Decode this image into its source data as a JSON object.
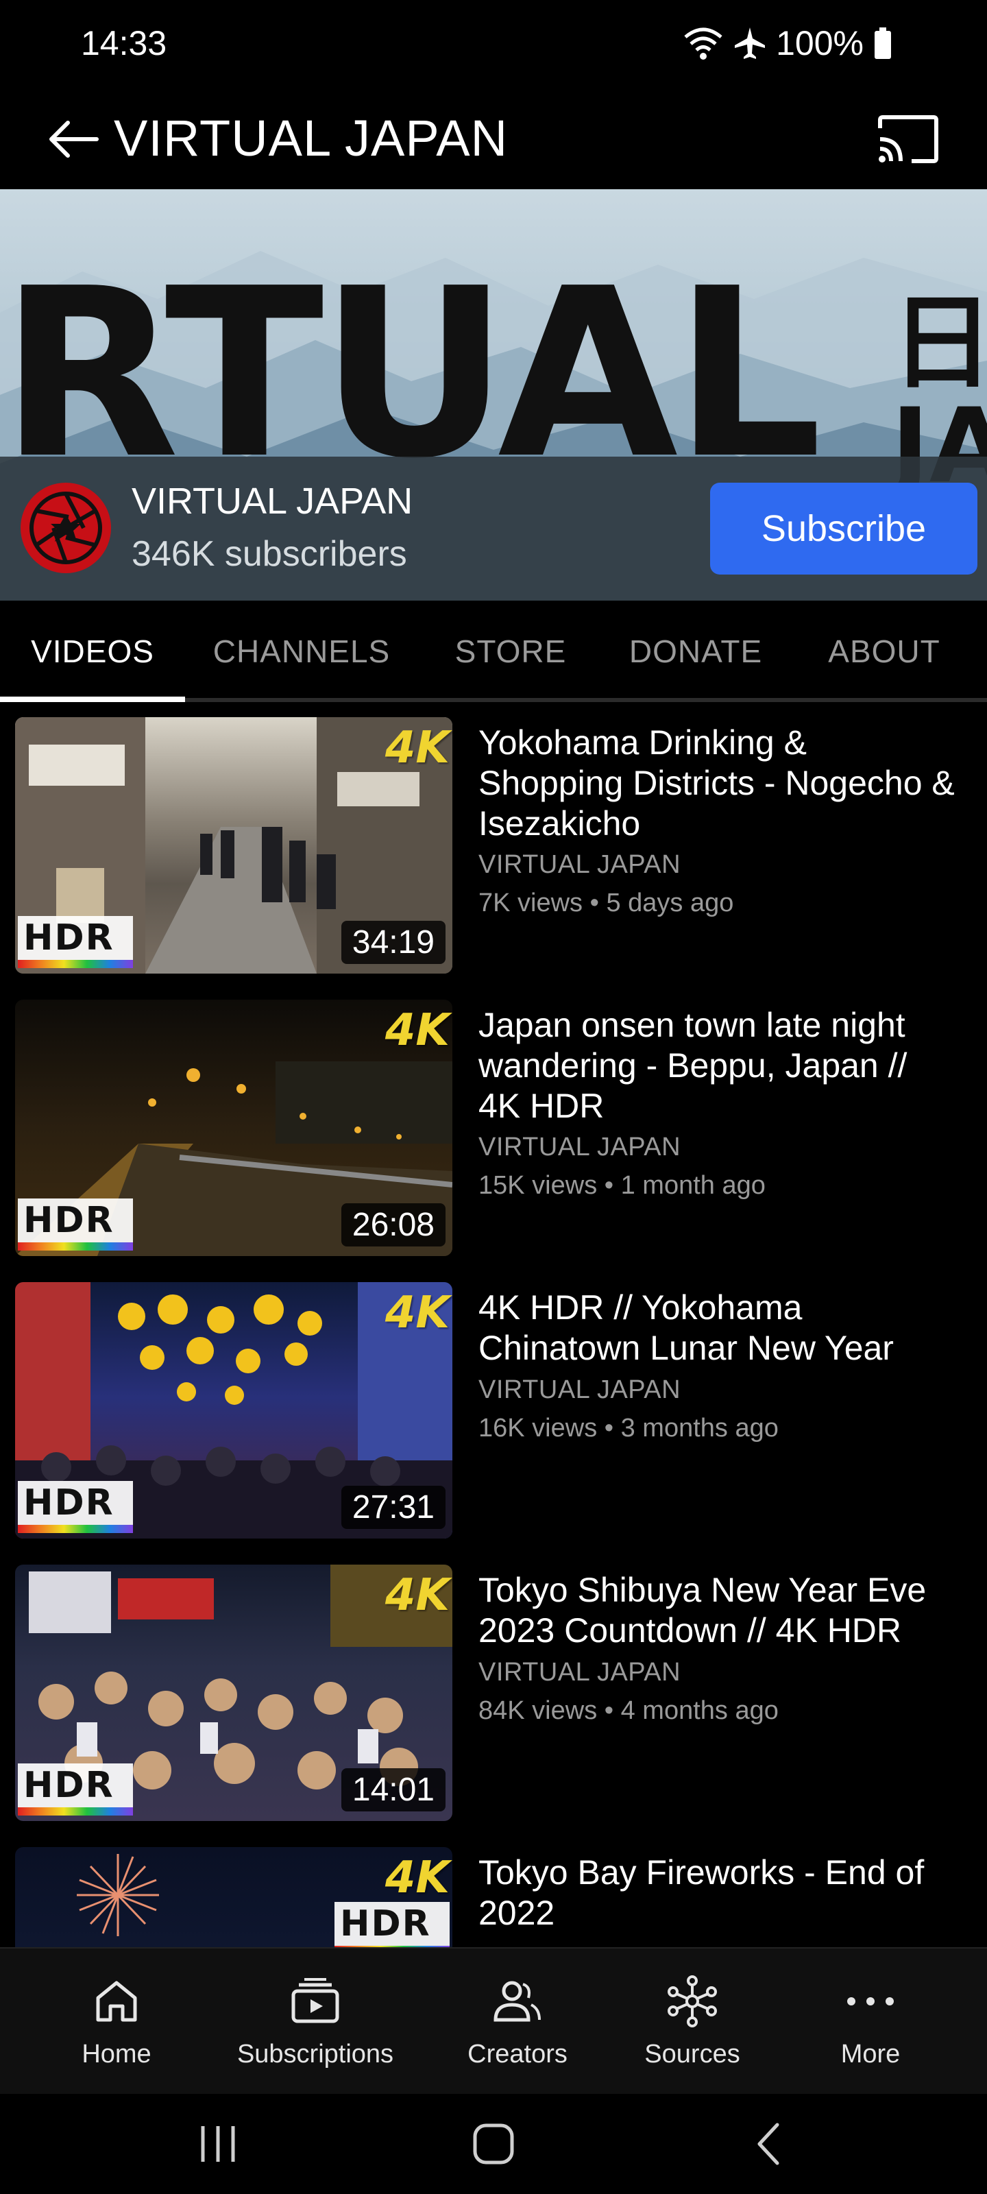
{
  "status": {
    "time": "14:33",
    "battery": "100%"
  },
  "app_bar": {
    "title": "VIRTUAL JAPAN"
  },
  "banner": {
    "big_text": "RTUAL",
    "side_text_top": "日本",
    "side_text_bottom": "JA"
  },
  "channel": {
    "name": "VIRTUAL JAPAN",
    "subscribers": "346K subscribers",
    "subscribe_label": "Subscribe"
  },
  "tabs": [
    {
      "label": "VIDEOS",
      "active": true
    },
    {
      "label": "CHANNELS",
      "active": false
    },
    {
      "label": "STORE",
      "active": false
    },
    {
      "label": "DONATE",
      "active": false
    },
    {
      "label": "ABOUT",
      "active": false
    }
  ],
  "videos": [
    {
      "title": "Yokohama Drinking & Shopping Districts - Nogecho & Isezakicho",
      "channel": "VIRTUAL JAPAN",
      "meta": "7K views • 5 days ago",
      "duration": "34:19",
      "badge": "4K",
      "hdr": "HDR"
    },
    {
      "title": "Japan onsen town late night wandering - Beppu, Japan // 4K HDR",
      "channel": "VIRTUAL JAPAN",
      "meta": "15K views • 1 month ago",
      "duration": "26:08",
      "badge": "4K",
      "hdr": "HDR"
    },
    {
      "title": "4K HDR // Yokohama Chinatown Lunar New Year",
      "channel": "VIRTUAL JAPAN",
      "meta": "16K views • 3 months ago",
      "duration": "27:31",
      "badge": "4K",
      "hdr": "HDR"
    },
    {
      "title": "Tokyo Shibuya New Year Eve 2023 Countdown // 4K HDR",
      "channel": "VIRTUAL JAPAN",
      "meta": "84K views • 4 months ago",
      "duration": "14:01",
      "badge": "4K",
      "hdr": "HDR"
    },
    {
      "title": "Tokyo Bay Fireworks - End of 2022",
      "channel": "",
      "meta": "",
      "duration": "",
      "badge": "4K",
      "hdr": "HDR"
    }
  ],
  "bottom_nav": [
    {
      "label": "Home",
      "icon": "home-icon"
    },
    {
      "label": "Subscriptions",
      "icon": "subscriptions-icon"
    },
    {
      "label": "Creators",
      "icon": "creators-icon"
    },
    {
      "label": "Sources",
      "icon": "sources-icon"
    },
    {
      "label": "More",
      "icon": "more-icon"
    }
  ],
  "colors": {
    "accent": "#2f6af0",
    "background": "#000000",
    "nav_background": "#101010"
  }
}
